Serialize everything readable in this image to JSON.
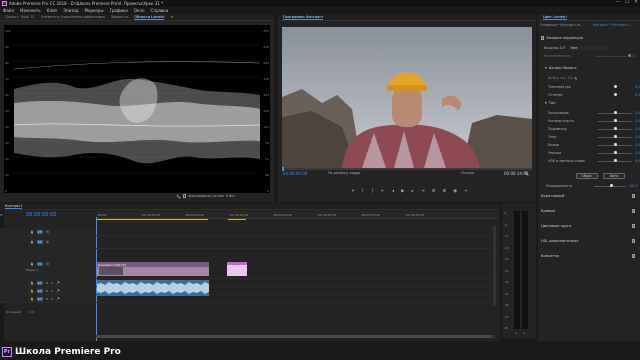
{
  "window": {
    "app_icon": "Pr",
    "title": "Adobe Premiere Pro CC 2018 - D:\\Школа Premiere Pro\\A. Проекты\\Урок 31 *",
    "controls": [
      "—",
      "☐",
      "✕"
    ]
  },
  "menu": [
    "Файл",
    "Изменить",
    "Клип",
    "Эпизод",
    "Маркеры",
    "Графика",
    "Окно",
    "Справка"
  ],
  "left_panel": {
    "tabs": [
      "Проект: Урок 31",
      "Элементы управления эффектами",
      "Эффекты",
      "Области Lumetri"
    ],
    "active_tab": 3,
    "axis_left": [
      "100",
      "90",
      "80",
      "70",
      "60",
      "50",
      "40",
      "30",
      "20",
      "10",
      "0"
    ],
    "axis_right": [
      "255",
      "230",
      "204",
      "178",
      "153",
      "128",
      "102",
      "76",
      "51",
      "26",
      "0"
    ],
    "clamp_label": "Фиксировать сигнал",
    "bit_label": "8 бит"
  },
  "program": {
    "title": "Программа: Контраст",
    "timecode_left": "00:00:00:00",
    "fit_label": "По размеру кадра",
    "quality": "Полное",
    "timecode_right": "00:00:14:08"
  },
  "timeline": {
    "tab": "Контраст",
    "timecode": "00:00:00:00",
    "ruler": [
      "00:00",
      "00:00:05:00",
      "00:00:10:00",
      "00:00:15:00",
      "00:00:20:00",
      "00:00:25:00",
      "00:00:30:00",
      "00:00:35:00"
    ],
    "tracks": [
      {
        "name": "V3",
        "kind": "video"
      },
      {
        "name": "V2",
        "kind": "video"
      },
      {
        "name": "V1",
        "kind": "video",
        "label": "Видео 1"
      },
      {
        "name": "A1",
        "kind": "audio"
      },
      {
        "name": "A2",
        "kind": "audio"
      },
      {
        "name": "A3",
        "kind": "audio"
      }
    ],
    "master_label": "Основной",
    "master_value": "0,0",
    "clip1_label": "Контраст.mp4 [V]",
    "meter_scale": [
      "0",
      "-6",
      "-12",
      "-18",
      "-24",
      "-30",
      "-36",
      "-42",
      "-48",
      "-54",
      "dB"
    ],
    "meter_footer": [
      "S",
      "S"
    ]
  },
  "lumetri": {
    "title": "Цвет Lumetri",
    "source_tab": "Основные * Контраст.m...",
    "clip_tab": "Контраст * Контраст....",
    "section_basic": "Базовая коррекция",
    "input_lut_label": "Входная LUT",
    "input_lut_value": "Нет",
    "intensity_label": "Интенсивность",
    "intensity_value": "100",
    "wb_label": "Баланс белого",
    "wb_picker_label": "Выбор кол. ББ",
    "temp_label": "Температура",
    "temp_value": "0,0",
    "tint_label": "Оттенок",
    "tint_value": "0,0",
    "tone_label": "Тон",
    "tone": [
      {
        "label": "Экспозиция",
        "value": "0,0"
      },
      {
        "label": "Контрастность",
        "value": "0,0"
      },
      {
        "label": "Подсветка",
        "value": "0,0"
      },
      {
        "label": "Тени",
        "value": "0,0"
      },
      {
        "label": "Белые",
        "value": "0,0"
      },
      {
        "label": "Черные",
        "value": "0,0"
      },
      {
        "label": "HDR в светлых тонах",
        "value": "0,0"
      }
    ],
    "reset_label": "Сброс",
    "auto_label": "Авто",
    "saturation_label": "Насыщенность",
    "saturation_value": "100,0",
    "sections": [
      "Креативный",
      "Кривые",
      "Цветовые круги",
      "HSL дополнительно",
      "Виньетка"
    ]
  },
  "brand": {
    "logo": "Pr",
    "text": "Школа Premiere Pro"
  }
}
